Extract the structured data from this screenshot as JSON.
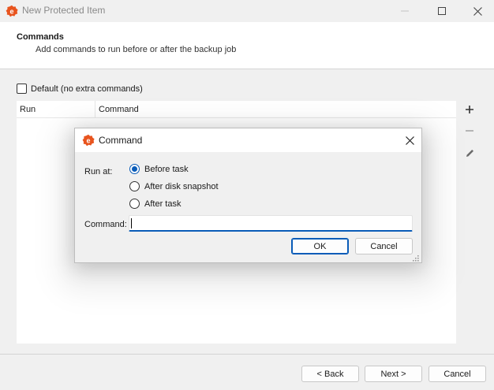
{
  "window": {
    "title": "New Protected Item"
  },
  "header": {
    "title": "Commands",
    "subtitle": "Add commands to run before or after the backup job"
  },
  "default_option": {
    "label": "Default (no extra commands)",
    "checked": false
  },
  "table": {
    "columns": [
      "Run",
      "Command"
    ],
    "rows": []
  },
  "footer": {
    "back_label": "< Back",
    "next_label": "Next >",
    "cancel_label": "Cancel"
  },
  "dialog": {
    "title": "Command",
    "run_at_label": "Run at:",
    "options": [
      "Before task",
      "After disk snapshot",
      "After task"
    ],
    "selected_option": "Before task",
    "command_label": "Command:",
    "command_value": "",
    "ok_label": "OK",
    "cancel_label": "Cancel"
  },
  "colors": {
    "accent": "#0a5cb8",
    "brand": "#e8541e"
  },
  "icons": {
    "app": "app-logo-icon",
    "add": "plus-icon",
    "remove": "minus-icon",
    "edit": "pencil-icon",
    "close": "close-icon",
    "minimize": "minimize-icon",
    "maximize": "maximize-icon",
    "resize": "resize-grip-icon"
  }
}
